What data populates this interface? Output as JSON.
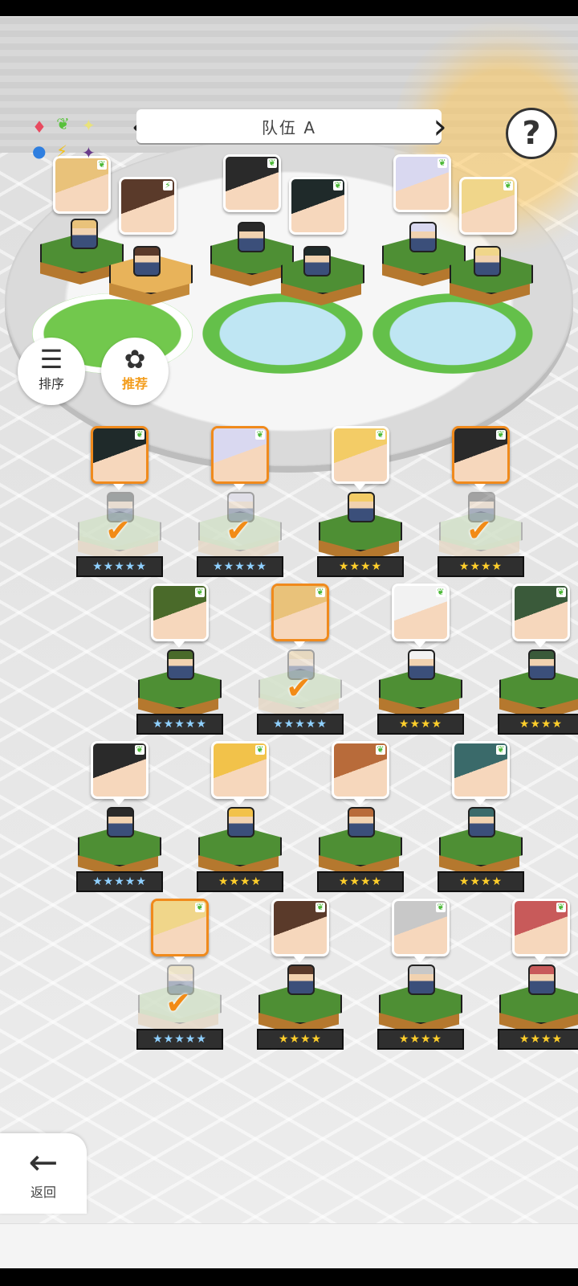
{
  "team": {
    "name": "队伍 A",
    "prev_icon": "chevron-left-icon",
    "next_icon": "chevron-right-icon"
  },
  "help": {
    "label": "?"
  },
  "buttons": {
    "sort_label": "排序",
    "recommend_label": "推荐",
    "back_label": "返回"
  },
  "elements": [
    {
      "icon": "fire-diamond-icon",
      "glyph": "♦",
      "color": "#e84a5f"
    },
    {
      "icon": "wind-leaf-icon",
      "glyph": "❦",
      "color": "#58c13b"
    },
    {
      "icon": "light-star-icon",
      "glyph": "✦",
      "color": "#e9e27a"
    },
    {
      "icon": "water-orb-icon",
      "glyph": "●",
      "color": "#2f7fe0"
    },
    {
      "icon": "thunder-bolt-icon",
      "glyph": "⚡",
      "color": "#f2c21b"
    },
    {
      "icon": "dark-star-icon",
      "glyph": "✦",
      "color": "#6a3c8a"
    }
  ],
  "team_members": [
    {
      "name": "hat-girl",
      "hair": "#e9c27a",
      "element": "wind"
    },
    {
      "name": "glasses-girl",
      "hair": "#5a3a2a",
      "element": "thunder"
    },
    {
      "name": "black-hair-boy",
      "hair": "#2a2a2a",
      "element": "wind"
    },
    {
      "name": "black-hair-girl",
      "hair": "#1f2a2a",
      "element": "wind"
    },
    {
      "name": "white-hair-girl",
      "hair": "#d9d8f0",
      "element": "wind"
    },
    {
      "name": "blonde-girl",
      "hair": "#f0d68a",
      "element": "wind"
    }
  ],
  "roster": [
    {
      "row": 0,
      "col": 0,
      "hair": "#1f2a2a",
      "stars": "★★★★★",
      "rarity": "blue",
      "selected": true
    },
    {
      "row": 0,
      "col": 1,
      "hair": "#d9d8f0",
      "stars": "★★★★★",
      "rarity": "blue",
      "selected": true
    },
    {
      "row": 0,
      "col": 2,
      "hair": "#f3cc66",
      "stars": "★★★★",
      "rarity": "gold",
      "selected": false
    },
    {
      "row": 0,
      "col": 3,
      "hair": "#2a2a2a",
      "stars": "★★★★",
      "rarity": "gold",
      "selected": true
    },
    {
      "row": 1,
      "col": 0,
      "hair": "#4a6a2a",
      "stars": "★★★★★",
      "rarity": "blue",
      "selected": false
    },
    {
      "row": 1,
      "col": 1,
      "hair": "#e9c27a",
      "stars": "★★★★★",
      "rarity": "blue",
      "selected": true
    },
    {
      "row": 1,
      "col": 2,
      "hair": "#f2f2f2",
      "stars": "★★★★",
      "rarity": "gold",
      "selected": false
    },
    {
      "row": 1,
      "col": 3,
      "hair": "#3a5a3a",
      "stars": "★★★★",
      "rarity": "gold",
      "selected": false
    },
    {
      "row": 2,
      "col": 0,
      "hair": "#2a2a2a",
      "stars": "★★★★★",
      "rarity": "blue",
      "selected": false
    },
    {
      "row": 2,
      "col": 1,
      "hair": "#f2c24a",
      "stars": "★★★★",
      "rarity": "gold",
      "selected": false
    },
    {
      "row": 2,
      "col": 2,
      "hair": "#b86b3a",
      "stars": "★★★★",
      "rarity": "gold",
      "selected": false
    },
    {
      "row": 2,
      "col": 3,
      "hair": "#3a6a6a",
      "stars": "★★★★",
      "rarity": "gold",
      "selected": false
    },
    {
      "row": 3,
      "col": 0,
      "hair": "#f0d68a",
      "stars": "★★★★★",
      "rarity": "blue",
      "selected": true
    },
    {
      "row": 3,
      "col": 1,
      "hair": "#5a3a2a",
      "stars": "★★★★",
      "rarity": "gold",
      "selected": false
    },
    {
      "row": 3,
      "col": 2,
      "hair": "#c8c8c8",
      "stars": "★★★★",
      "rarity": "gold",
      "selected": false
    },
    {
      "row": 3,
      "col": 3,
      "hair": "#c85a5a",
      "stars": "★★★★",
      "rarity": "gold",
      "selected": false
    }
  ]
}
